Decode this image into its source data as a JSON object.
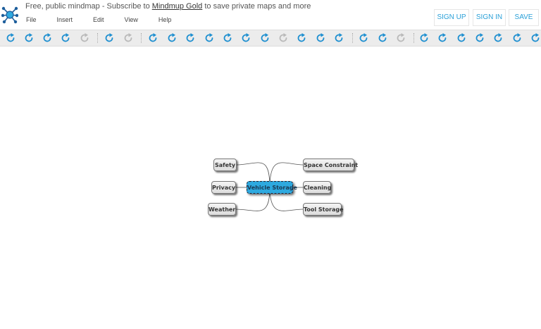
{
  "header": {
    "promo_prefix": "Free, public mindmap - Subscribe to ",
    "promo_link": "Mindmup Gold",
    "promo_suffix": " to save private maps and more"
  },
  "menu": [
    "File",
    "Insert",
    "Edit",
    "View",
    "Help"
  ],
  "buttons": {
    "signup": "SIGN UP",
    "signin": "SIGN IN",
    "save": "SAVE"
  },
  "colors": {
    "accent": "#2aa0d8",
    "root_node": "#2ea9df",
    "toolbar_bg": "#ececec"
  },
  "toolbar": {
    "icon": "redo-icon",
    "icon_count": 29
  },
  "map": {
    "root": "Vehicle Storage",
    "nodes": [
      "Safety",
      "Privacy",
      "Weather",
      "Space Constraint",
      "Cleaning",
      "Tool Storage"
    ]
  }
}
